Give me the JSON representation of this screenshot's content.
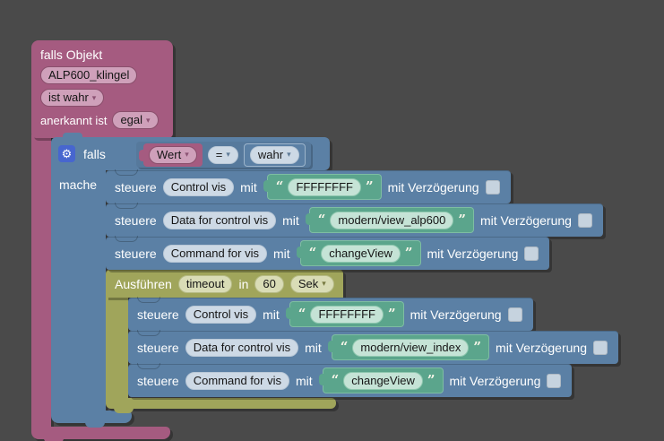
{
  "blocks": {
    "trigger": {
      "title": "falls Objekt",
      "object": "ALP600_klingel",
      "condition": "ist wahr",
      "ack_label": "anerkannt ist",
      "ack_value": "egal"
    },
    "if": {
      "label": "falls",
      "do_label": "mache",
      "compare": {
        "left": "Wert",
        "op": "=",
        "right": "wahr"
      }
    },
    "timeout": {
      "label": "Ausführen",
      "name": "timeout",
      "in_label": "in",
      "value": "60",
      "unit": "Sek"
    },
    "control_labels": {
      "verb": "steuere",
      "with": "mit",
      "delay": "mit Verzögerung"
    },
    "rows": [
      {
        "state": "Control vis",
        "value": "FFFFFFFF"
      },
      {
        "state": "Data for control vis",
        "value": "modern/view_alp600"
      },
      {
        "state": "Command for vis",
        "value": "changeView"
      },
      {
        "state": "Control vis",
        "value": "FFFFFFFF"
      },
      {
        "state": "Data for control vis",
        "value": "modern/view_index"
      },
      {
        "state": "Command for vis",
        "value": "changeView"
      }
    ]
  },
  "icons": {
    "gear": "⚙",
    "dropdown_arrow": "▾"
  },
  "colors": {
    "background": "#4a4a4a",
    "trigger_pink": "#a55b80",
    "logic_blue": "#5b80a5",
    "string_green": "#5ba58c",
    "timer_olive": "#a0a55b",
    "gear_blue": "#4766cf"
  }
}
